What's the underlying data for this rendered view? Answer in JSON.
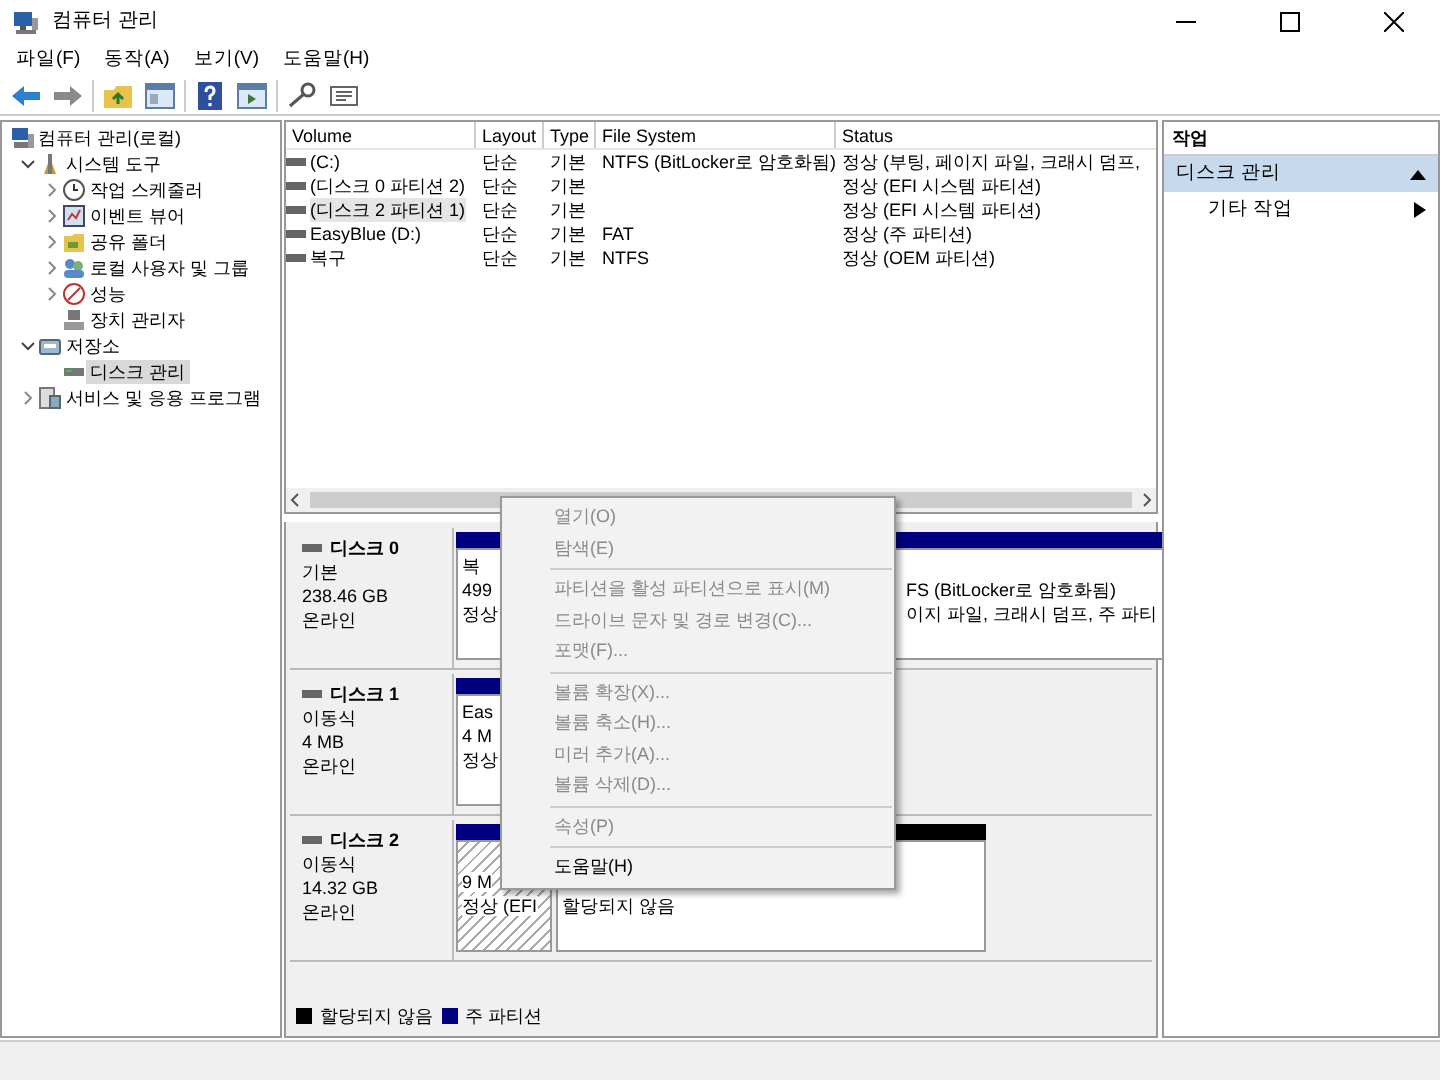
{
  "window": {
    "title": "컴퓨터 관리"
  },
  "menu": [
    "파일(F)",
    "동작(A)",
    "보기(V)",
    "도움말(H)"
  ],
  "tree": [
    {
      "label": "컴퓨터 관리(로컬)",
      "selected": false,
      "children": [
        {
          "label": "시스템 도구",
          "expanded": true,
          "selected": false,
          "children": [
            {
              "label": "작업 스케줄러",
              "expanded": false,
              "selected": false
            },
            {
              "label": "이벤트 뷰어",
              "expanded": false,
              "selected": false
            },
            {
              "label": "공유 폴더",
              "expanded": false,
              "selected": false
            },
            {
              "label": "로컬 사용자 및 그룹",
              "expanded": false,
              "selected": false
            },
            {
              "label": "성능",
              "expanded": false,
              "selected": false
            },
            {
              "label": "장치 관리자",
              "selected": false
            }
          ]
        },
        {
          "label": "저장소",
          "expanded": true,
          "selected": false,
          "children": [
            {
              "label": "디스크 관리",
              "selected": true
            }
          ]
        },
        {
          "label": "서비스 및 응용 프로그램",
          "expanded": false,
          "selected": false
        }
      ]
    }
  ],
  "volumes": {
    "columns": [
      "Volume",
      "Layout",
      "Type",
      "File System",
      "Status"
    ],
    "rows": [
      {
        "volume": "(C:)",
        "layout": "단순",
        "type": "기본",
        "file_system": "NTFS (BitLocker로 암호화됨)",
        "status": "정상 (부팅, 페이지 파일, 크래시 덤프,",
        "selected": false
      },
      {
        "volume": "(디스크 0 파티션 2)",
        "layout": "단순",
        "type": "기본",
        "status": "정상 (EFI 시스템 파티션)",
        "selected": false
      },
      {
        "volume": "(디스크 2 파티션 1)",
        "layout": "단순",
        "type": "기본",
        "status": "정상 (EFI 시스템 파티션)",
        "selected": true
      },
      {
        "volume": "EasyBlue (D:)",
        "layout": "단순",
        "type": "기본",
        "file_system": "FAT",
        "status": "정상 (주 파티션)",
        "selected": false
      },
      {
        "volume": "복구",
        "layout": "단순",
        "type": "기본",
        "file_system": "NTFS",
        "status": "정상 (OEM 파티션)",
        "selected": false
      }
    ]
  },
  "disks": [
    {
      "name": "디스크 0",
      "lines": [
        "기본",
        "238.46 GB",
        "온라인"
      ],
      "partitions": [
        {
          "lines": [
            "복",
            "499",
            "정상"
          ],
          "color": "#000080",
          "selected": false
        },
        {
          "lines": [
            "FS (BitLocker로 암호화됨)",
            "이지 파일, 크래시 덤프, 주 파티"
          ],
          "color": "#000080",
          "selected": false
        }
      ]
    },
    {
      "name": "디스크 1",
      "lines": [
        "이동식",
        "4 MB",
        "온라인"
      ],
      "partitions": [
        {
          "lines": [
            "Eas",
            "4 M",
            "정상"
          ],
          "color": "#000080",
          "selected": false
        }
      ]
    },
    {
      "name": "디스크 2",
      "lines": [
        "이동식",
        "14.32 GB",
        "온라인"
      ],
      "partitions": [
        {
          "lines": [
            "9 M",
            "정상 (EFI"
          ],
          "color": "#000080",
          "selected": true
        },
        {
          "lines": [
            "할당되지 않음"
          ],
          "color": "#000000",
          "selected": false
        }
      ]
    }
  ],
  "legend": [
    {
      "label": "할당되지 않음",
      "color": "#000000"
    },
    {
      "label": "주 파티션",
      "color": "#000080"
    }
  ],
  "actions": {
    "title": "작업",
    "sections": [
      {
        "label": "디스크 관리",
        "expanded": true,
        "items": [
          {
            "label": "기타 작업"
          }
        ]
      }
    ]
  },
  "context_menu": [
    {
      "kind": "item",
      "label": "열기(O)",
      "disabled": true
    },
    {
      "kind": "item",
      "label": "탐색(E)",
      "disabled": true
    },
    {
      "kind": "separator"
    },
    {
      "kind": "item",
      "label": "파티션을 활성 파티션으로 표시(M)",
      "disabled": true
    },
    {
      "kind": "item",
      "label": "드라이브 문자 및 경로 변경(C)...",
      "disabled": true
    },
    {
      "kind": "item",
      "label": "포맷(F)...",
      "disabled": true
    },
    {
      "kind": "separator"
    },
    {
      "kind": "item",
      "label": "볼륨 확장(X)...",
      "disabled": true
    },
    {
      "kind": "item",
      "label": "볼륨 축소(H)...",
      "disabled": true
    },
    {
      "kind": "item",
      "label": "미러 추가(A)...",
      "disabled": true
    },
    {
      "kind": "item",
      "label": "볼륨 삭제(D)...",
      "disabled": true
    },
    {
      "kind": "separator"
    },
    {
      "kind": "item",
      "label": "속성(P)",
      "disabled": true
    },
    {
      "kind": "separator"
    },
    {
      "kind": "item",
      "label": "도움말(H)",
      "disabled": false
    }
  ]
}
